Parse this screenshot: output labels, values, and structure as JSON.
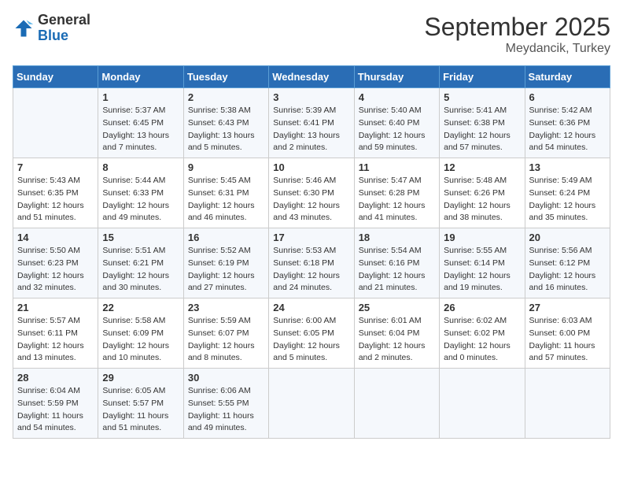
{
  "header": {
    "logo_general": "General",
    "logo_blue": "Blue",
    "month_title": "September 2025",
    "subtitle": "Meydancik, Turkey"
  },
  "days_of_week": [
    "Sunday",
    "Monday",
    "Tuesday",
    "Wednesday",
    "Thursday",
    "Friday",
    "Saturday"
  ],
  "weeks": [
    [
      {
        "day": "",
        "info": ""
      },
      {
        "day": "1",
        "info": "Sunrise: 5:37 AM\nSunset: 6:45 PM\nDaylight: 13 hours\nand 7 minutes."
      },
      {
        "day": "2",
        "info": "Sunrise: 5:38 AM\nSunset: 6:43 PM\nDaylight: 13 hours\nand 5 minutes."
      },
      {
        "day": "3",
        "info": "Sunrise: 5:39 AM\nSunset: 6:41 PM\nDaylight: 13 hours\nand 2 minutes."
      },
      {
        "day": "4",
        "info": "Sunrise: 5:40 AM\nSunset: 6:40 PM\nDaylight: 12 hours\nand 59 minutes."
      },
      {
        "day": "5",
        "info": "Sunrise: 5:41 AM\nSunset: 6:38 PM\nDaylight: 12 hours\nand 57 minutes."
      },
      {
        "day": "6",
        "info": "Sunrise: 5:42 AM\nSunset: 6:36 PM\nDaylight: 12 hours\nand 54 minutes."
      }
    ],
    [
      {
        "day": "7",
        "info": "Sunrise: 5:43 AM\nSunset: 6:35 PM\nDaylight: 12 hours\nand 51 minutes."
      },
      {
        "day": "8",
        "info": "Sunrise: 5:44 AM\nSunset: 6:33 PM\nDaylight: 12 hours\nand 49 minutes."
      },
      {
        "day": "9",
        "info": "Sunrise: 5:45 AM\nSunset: 6:31 PM\nDaylight: 12 hours\nand 46 minutes."
      },
      {
        "day": "10",
        "info": "Sunrise: 5:46 AM\nSunset: 6:30 PM\nDaylight: 12 hours\nand 43 minutes."
      },
      {
        "day": "11",
        "info": "Sunrise: 5:47 AM\nSunset: 6:28 PM\nDaylight: 12 hours\nand 41 minutes."
      },
      {
        "day": "12",
        "info": "Sunrise: 5:48 AM\nSunset: 6:26 PM\nDaylight: 12 hours\nand 38 minutes."
      },
      {
        "day": "13",
        "info": "Sunrise: 5:49 AM\nSunset: 6:24 PM\nDaylight: 12 hours\nand 35 minutes."
      }
    ],
    [
      {
        "day": "14",
        "info": "Sunrise: 5:50 AM\nSunset: 6:23 PM\nDaylight: 12 hours\nand 32 minutes."
      },
      {
        "day": "15",
        "info": "Sunrise: 5:51 AM\nSunset: 6:21 PM\nDaylight: 12 hours\nand 30 minutes."
      },
      {
        "day": "16",
        "info": "Sunrise: 5:52 AM\nSunset: 6:19 PM\nDaylight: 12 hours\nand 27 minutes."
      },
      {
        "day": "17",
        "info": "Sunrise: 5:53 AM\nSunset: 6:18 PM\nDaylight: 12 hours\nand 24 minutes."
      },
      {
        "day": "18",
        "info": "Sunrise: 5:54 AM\nSunset: 6:16 PM\nDaylight: 12 hours\nand 21 minutes."
      },
      {
        "day": "19",
        "info": "Sunrise: 5:55 AM\nSunset: 6:14 PM\nDaylight: 12 hours\nand 19 minutes."
      },
      {
        "day": "20",
        "info": "Sunrise: 5:56 AM\nSunset: 6:12 PM\nDaylight: 12 hours\nand 16 minutes."
      }
    ],
    [
      {
        "day": "21",
        "info": "Sunrise: 5:57 AM\nSunset: 6:11 PM\nDaylight: 12 hours\nand 13 minutes."
      },
      {
        "day": "22",
        "info": "Sunrise: 5:58 AM\nSunset: 6:09 PM\nDaylight: 12 hours\nand 10 minutes."
      },
      {
        "day": "23",
        "info": "Sunrise: 5:59 AM\nSunset: 6:07 PM\nDaylight: 12 hours\nand 8 minutes."
      },
      {
        "day": "24",
        "info": "Sunrise: 6:00 AM\nSunset: 6:05 PM\nDaylight: 12 hours\nand 5 minutes."
      },
      {
        "day": "25",
        "info": "Sunrise: 6:01 AM\nSunset: 6:04 PM\nDaylight: 12 hours\nand 2 minutes."
      },
      {
        "day": "26",
        "info": "Sunrise: 6:02 AM\nSunset: 6:02 PM\nDaylight: 12 hours\nand 0 minutes."
      },
      {
        "day": "27",
        "info": "Sunrise: 6:03 AM\nSunset: 6:00 PM\nDaylight: 11 hours\nand 57 minutes."
      }
    ],
    [
      {
        "day": "28",
        "info": "Sunrise: 6:04 AM\nSunset: 5:59 PM\nDaylight: 11 hours\nand 54 minutes."
      },
      {
        "day": "29",
        "info": "Sunrise: 6:05 AM\nSunset: 5:57 PM\nDaylight: 11 hours\nand 51 minutes."
      },
      {
        "day": "30",
        "info": "Sunrise: 6:06 AM\nSunset: 5:55 PM\nDaylight: 11 hours\nand 49 minutes."
      },
      {
        "day": "",
        "info": ""
      },
      {
        "day": "",
        "info": ""
      },
      {
        "day": "",
        "info": ""
      },
      {
        "day": "",
        "info": ""
      }
    ]
  ]
}
